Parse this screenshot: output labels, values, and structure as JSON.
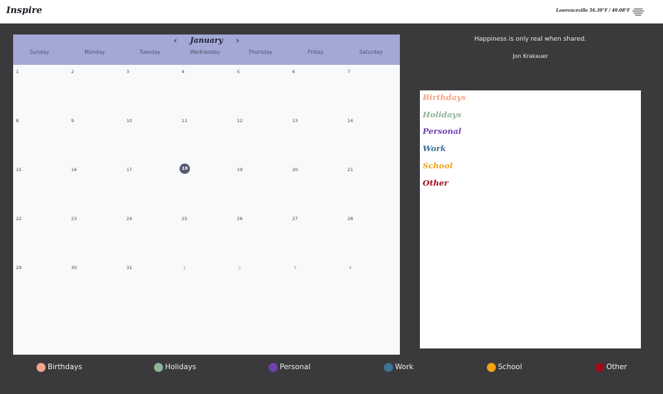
{
  "app": {
    "title": "Inspire"
  },
  "weather": {
    "text": "Lawrenceville 56.39°F / 49.08°F",
    "icon": "fog-icon"
  },
  "calendar": {
    "month": "January",
    "weekdays": [
      "Sunday",
      "Monday",
      "Tuesday",
      "Wednesday",
      "Thursday",
      "Friday",
      "Saturday"
    ],
    "weeks": [
      [
        "1",
        "2",
        "3",
        "4",
        "5",
        "6",
        "7"
      ],
      [
        "8",
        "9",
        "10",
        "11",
        "12",
        "13",
        "14"
      ],
      [
        "15",
        "16",
        "17",
        "18",
        "19",
        "20",
        "21"
      ],
      [
        "22",
        "23",
        "24",
        "25",
        "26",
        "27",
        "28"
      ],
      [
        "29",
        "30",
        "31",
        "1",
        "2",
        "3",
        "4"
      ]
    ],
    "today": "18",
    "prev_icon": "‹",
    "next_icon": "›"
  },
  "quote": {
    "text": "Happiness is only real when shared.",
    "author": "Jon Krakauer"
  },
  "categories": [
    {
      "label": "Birthdays",
      "color": "#f4a58a"
    },
    {
      "label": "Holidays",
      "color": "#8fb49a"
    },
    {
      "label": "Personal",
      "color": "#7040b0"
    },
    {
      "label": "Work",
      "color": "#3f7294"
    },
    {
      "label": "School",
      "color": "#f5a312"
    },
    {
      "label": "Other",
      "color": "#9e0a1a"
    }
  ]
}
